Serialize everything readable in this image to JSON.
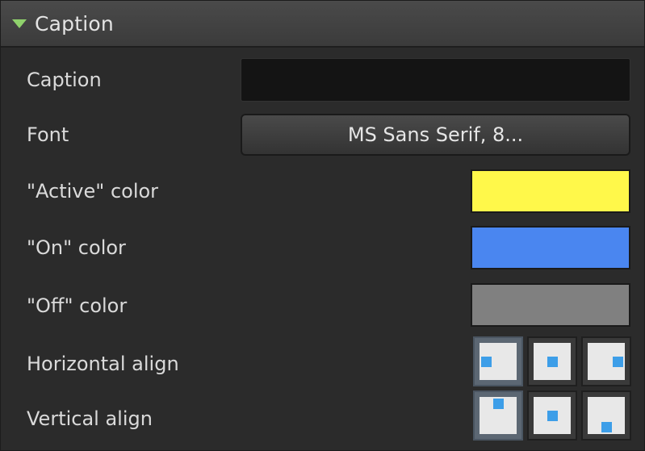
{
  "section": {
    "title": "Caption",
    "expand_icon": "triangle-down-icon"
  },
  "properties": {
    "caption": {
      "label": "Caption",
      "value": ""
    },
    "font": {
      "label": "Font",
      "value": "MS Sans Serif, 8..."
    },
    "active_color": {
      "label": "\"Active\" color",
      "color": "#fff84a"
    },
    "on_color": {
      "label": "\"On\" color",
      "color": "#4a86f0"
    },
    "off_color": {
      "label": "\"Off\" color",
      "color": "#808080"
    },
    "horizontal_align": {
      "label": "Horizontal align",
      "options": [
        "left",
        "center",
        "right"
      ],
      "selected": "left"
    },
    "vertical_align": {
      "label": "Vertical align",
      "options": [
        "top",
        "middle",
        "bottom"
      ],
      "selected": "top"
    }
  },
  "colors": {
    "accent": "#8fd16c",
    "align_indicator": "#3d9ee8"
  }
}
